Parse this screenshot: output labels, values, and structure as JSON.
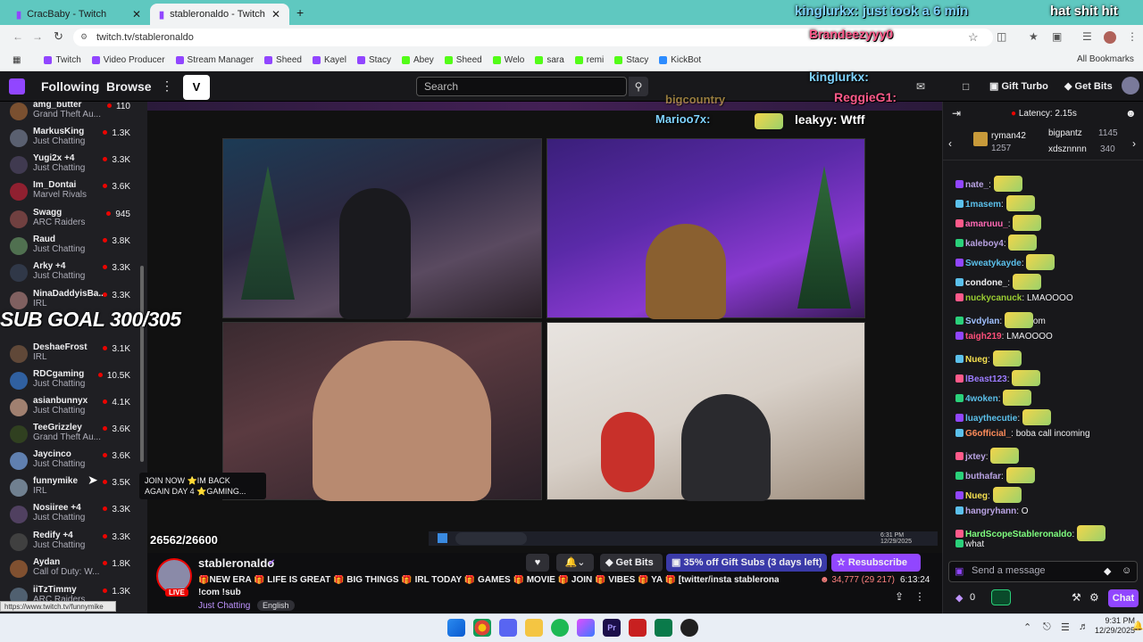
{
  "browser": {
    "tabs": [
      {
        "title": "CracBaby - Twitch"
      },
      {
        "title": "stableronaldo - Twitch"
      }
    ],
    "url": "twitch.tv/stableronaldo",
    "bookmarks": [
      "Twitch",
      "Video Producer",
      "Stream Manager",
      "Sheed",
      "Kayel",
      "Stacy",
      "Abey",
      "Sheed",
      "Welo",
      "sara",
      "remi",
      "Stacy",
      "KickBot"
    ],
    "all_bookmarks": "All Bookmarks",
    "status_url": "https://www.twitch.tv/funnymike"
  },
  "topnav": {
    "following": "Following",
    "browse": "Browse",
    "search_placeholder": "Search",
    "gift_turbo": "Gift Turbo",
    "get_bits": "Get Bits"
  },
  "sidebar": {
    "channels": [
      {
        "name": "amg_butter",
        "game": "Grand Theft Au...",
        "viewers": "110",
        "color": "#7a5030"
      },
      {
        "name": "MarkusKing",
        "game": "Just Chatting",
        "viewers": "1.3K",
        "color": "#5a6070"
      },
      {
        "name": "Yugi2x +4",
        "game": "Just Chatting",
        "viewers": "3.3K",
        "color": "#403a50"
      },
      {
        "name": "Im_Dontai",
        "game": "Marvel Rivals",
        "viewers": "3.6K",
        "color": "#902030"
      },
      {
        "name": "Swagg",
        "game": "ARC Raiders",
        "viewers": "945",
        "color": "#704040"
      },
      {
        "name": "Raud",
        "game": "Just Chatting",
        "viewers": "3.8K",
        "color": "#507050"
      },
      {
        "name": "Arky +4",
        "game": "Just Chatting",
        "viewers": "3.3K",
        "color": "#303848"
      },
      {
        "name": "NinaDaddyisBa...",
        "game": "IRL",
        "viewers": "3.3K",
        "color": "#806060"
      },
      {
        "name": "",
        "game": "",
        "viewers": "",
        "color": "#1f1f23"
      },
      {
        "name": "DeshaeFrost",
        "game": "IRL",
        "viewers": "3.1K",
        "color": "#604838"
      },
      {
        "name": "RDCgaming",
        "game": "Just Chatting",
        "viewers": "10.5K",
        "color": "#3060a0"
      },
      {
        "name": "asianbunnyx",
        "game": "Just Chatting",
        "viewers": "4.1K",
        "color": "#a08070"
      },
      {
        "name": "TeeGrizzley",
        "game": "Grand Theft Au...",
        "viewers": "3.6K",
        "color": "#304020"
      },
      {
        "name": "Jaycinco",
        "game": "Just Chatting",
        "viewers": "3.6K",
        "color": "#6080b0"
      },
      {
        "name": "funnymike",
        "game": "IRL",
        "viewers": "3.5K",
        "color": "#708090"
      },
      {
        "name": "Nosiiree +4",
        "game": "Just Chatting",
        "viewers": "3.3K",
        "color": "#504060"
      },
      {
        "name": "Redify +4",
        "game": "Just Chatting",
        "viewers": "3.3K",
        "color": "#404040"
      },
      {
        "name": "Aydan",
        "game": "Call of Duty: W...",
        "viewers": "1.8K",
        "color": "#805030"
      },
      {
        "name": "iiTzTimmy",
        "game": "ARC Raiders",
        "viewers": "1.3K",
        "color": "#506070"
      }
    ]
  },
  "overlays": {
    "sub_goal": "SUB GOAL 300/305",
    "sub_count": "26562/26600",
    "tooltip_line1": "JOIN NOW ⭐IM BACK",
    "tooltip_line2": "AGAIN DAY 4 ⭐GAMING...",
    "stream_top_chat": "kinglurkx: just took a 6 min",
    "stream_top_chat_end": "hat shit hit",
    "stream_users": [
      "Brandeezyyy0",
      "kinglurkx:",
      "ReggieG1:",
      "Marioo7x:",
      "leakyy: Wtff"
    ],
    "stream_scroll_name": "bigcountry",
    "stream_clock": "6:31 PM",
    "stream_date": "12/29/2025"
  },
  "stream_info": {
    "channel": "stableronaldo",
    "live": "LIVE",
    "title": "🎁NEW ERA 🎁 LIFE IS GREAT 🎁 BIG THINGS 🎁 IRL TODAY 🎁 GAMES 🎁 MOVIE 🎁 JOIN 🎁 VIBES 🎁 YA 🎁 [twitter/insta stableronaldo] !po",
    "title2": "!com !sub",
    "category": "Just Chatting",
    "tag": "English",
    "get_bits": "Get Bits",
    "gift_subs": "35% off Gift Subs (3 days left)",
    "resubscribe": "Resubscribe",
    "viewers": "34,777 (29 217)",
    "uptime": "6:13:24"
  },
  "chat": {
    "latency": "Latency: 2.15s",
    "leaders": [
      {
        "name": "ryman42",
        "count": "1257"
      },
      {
        "name": "bigpantz",
        "count": "1145"
      },
      {
        "name": "xdsznnnn",
        "count": "340"
      }
    ],
    "messages": [
      {
        "user": "nate_",
        "text": "",
        "color": "#b9a3e3",
        "emote": true
      },
      {
        "user": "1masem",
        "text": "",
        "color": "#5bc0eb",
        "emote": true
      },
      {
        "user": "amaruuu_",
        "text": "",
        "color": "#ff69b4",
        "emote": true
      },
      {
        "user": "kaleboy4",
        "text": "",
        "color": "#b9a3e3",
        "emote": true
      },
      {
        "user": "Sweatykayde",
        "text": "",
        "color": "#5bc0eb",
        "emote": true
      },
      {
        "user": "condone_",
        "text": "",
        "color": "#efeff1",
        "emote": true
      },
      {
        "user": "nuckycanuck",
        "text": "LMAOOOO",
        "color": "#9acd32",
        "emote": false
      },
      {
        "user": "Svdylan",
        "text": "om",
        "color": "#a0c0ff",
        "emote": true
      },
      {
        "user": "taigh219",
        "text": "LMAOOOO",
        "color": "#ff4f7a",
        "emote": false
      },
      {
        "user": "Nueg",
        "text": "",
        "color": "#f5e050",
        "emote": true
      },
      {
        "user": "lBeast123",
        "text": "",
        "color": "#9c7cff",
        "emote": true
      },
      {
        "user": "4woken",
        "text": "",
        "color": "#5bc0eb",
        "emote": true
      },
      {
        "user": "luaythecutie",
        "text": "",
        "color": "#5bc0eb",
        "emote": true
      },
      {
        "user": "G6official_",
        "text": "boba call incoming",
        "color": "#ff8c5a",
        "emote": false
      },
      {
        "user": "jxtey",
        "text": "",
        "color": "#b9a3e3",
        "emote": true
      },
      {
        "user": "buthafar",
        "text": "",
        "color": "#b9a3e3",
        "emote": true
      },
      {
        "user": "Nueg",
        "text": "",
        "color": "#f5e050",
        "emote": true
      },
      {
        "user": "hangryhann",
        "text": "O",
        "color": "#b9a3e3",
        "emote": false
      },
      {
        "user": "HardScopeStableronaldo",
        "text": "",
        "color": "#7fff7f",
        "emote": true
      },
      {
        "user": "",
        "text": "what",
        "color": "#efeff1",
        "emote": false
      }
    ],
    "send_placeholder": "Send a message",
    "points": "0",
    "chat_button": "Chat"
  },
  "taskbar": {
    "time": "9:31 PM",
    "date": "12/29/2025"
  }
}
